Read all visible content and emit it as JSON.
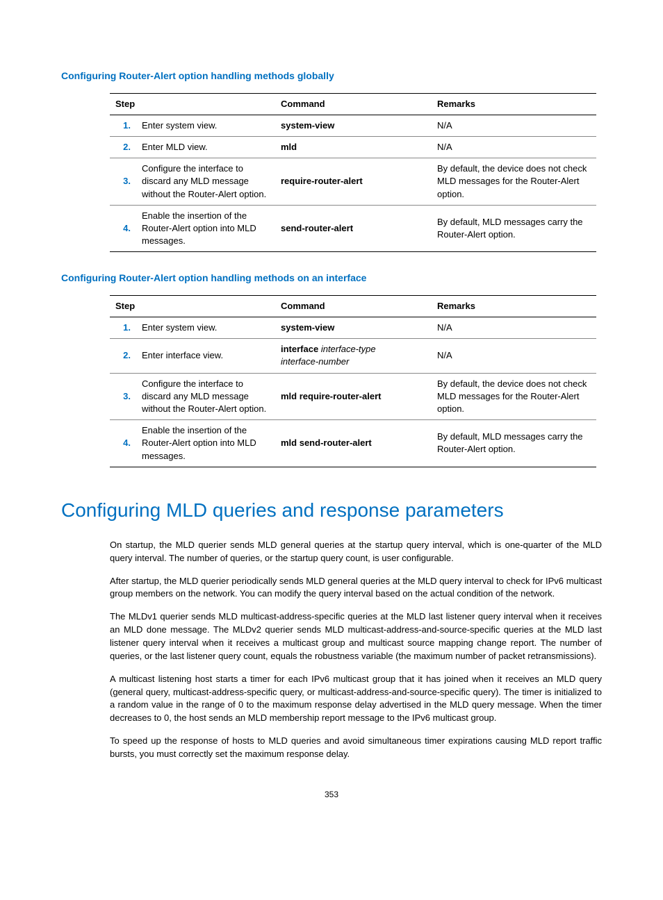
{
  "headings": {
    "globally": "Configuring Router-Alert option handling methods globally",
    "interface": "Configuring Router-Alert option handling methods on an interface",
    "big": "Configuring MLD queries and response parameters"
  },
  "table_headers": {
    "step": "Step",
    "command": "Command",
    "remarks": "Remarks"
  },
  "table1": {
    "r1": {
      "n": "1.",
      "step": "Enter system view.",
      "cmd": "system-view",
      "rem": "N/A"
    },
    "r2": {
      "n": "2.",
      "step": "Enter MLD view.",
      "cmd": "mld",
      "rem": "N/A"
    },
    "r3": {
      "n": "3.",
      "step": "Configure the interface to discard any MLD message without the Router-Alert option.",
      "cmd": "require-router-alert",
      "rem": "By default, the device does not check MLD messages for the Router-Alert option."
    },
    "r4": {
      "n": "4.",
      "step": "Enable the insertion of the Router-Alert option into MLD messages.",
      "cmd": "send-router-alert",
      "rem": "By default, MLD messages carry the Router-Alert option."
    }
  },
  "table2": {
    "r1": {
      "n": "1.",
      "step": "Enter system view.",
      "cmd": "system-view",
      "rem": "N/A"
    },
    "r2": {
      "n": "2.",
      "step": "Enter interface view.",
      "cmd_b": "interface",
      "cmd_i1": "interface-type",
      "cmd_i2": "interface-number",
      "rem": "N/A"
    },
    "r3": {
      "n": "3.",
      "step": "Configure the interface to discard any MLD message without the Router-Alert option.",
      "cmd": "mld require-router-alert",
      "rem": "By default, the device does not check MLD messages for the Router-Alert option."
    },
    "r4": {
      "n": "4.",
      "step": "Enable the insertion of the Router-Alert option into MLD messages.",
      "cmd": "mld send-router-alert",
      "rem": "By default, MLD messages carry the Router-Alert option."
    }
  },
  "paras": {
    "p1": "On startup, the MLD querier sends MLD general queries at the startup query interval, which is one-quarter of the MLD query interval. The number of queries, or the startup query count, is user configurable.",
    "p2": "After startup, the MLD querier periodically sends MLD general queries at the MLD query interval to check for IPv6 multicast group members on the network. You can modify the query interval based on the actual condition of the network.",
    "p3": "The MLDv1 querier sends MLD multicast-address-specific queries at the MLD last listener query interval when it receives an MLD done message. The MLDv2 querier sends MLD multicast-address-and-source-specific queries at the MLD last listener query interval when it receives a multicast group and multicast source mapping change report. The number of queries, or the last listener query count, equals the robustness variable (the maximum number of packet retransmissions).",
    "p4": "A multicast listening host starts a timer for each IPv6 multicast group that it has joined when it receives an MLD query (general query, multicast-address-specific query, or multicast-address-and-source-specific query). The timer is initialized to a random value in the range of 0 to the maximum response delay advertised in the MLD query message. When the timer decreases to 0, the host sends an MLD membership report message to the IPv6 multicast group.",
    "p5": "To speed up the response of hosts to MLD queries and avoid simultaneous timer expirations causing MLD report traffic bursts, you must correctly set the maximum response delay."
  },
  "page_number": "353"
}
